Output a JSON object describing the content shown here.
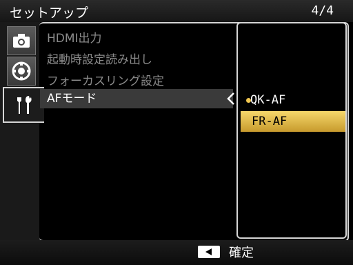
{
  "header": {
    "title": "セットアップ",
    "page_indicator": "4/4"
  },
  "sidebar": {
    "tabs": [
      {
        "icon": "camera-icon"
      },
      {
        "icon": "dial-icon"
      },
      {
        "icon": "tools-icon",
        "active": true
      }
    ]
  },
  "menu": {
    "items": [
      {
        "label": "HDMI出力"
      },
      {
        "label": "起動時設定読み出し"
      },
      {
        "label": "フォーカスリング設定"
      },
      {
        "label": "AFモード",
        "selected": true
      }
    ]
  },
  "submenu": {
    "options": [
      {
        "label": "QK-AF",
        "current": true
      },
      {
        "label": "FR-AF",
        "highlighted": true
      }
    ]
  },
  "footer": {
    "confirm_label": "確定"
  },
  "colors": {
    "highlight": "#e0b84a",
    "frame": "#d6d6d6",
    "dim_text": "#8a8a8a"
  }
}
